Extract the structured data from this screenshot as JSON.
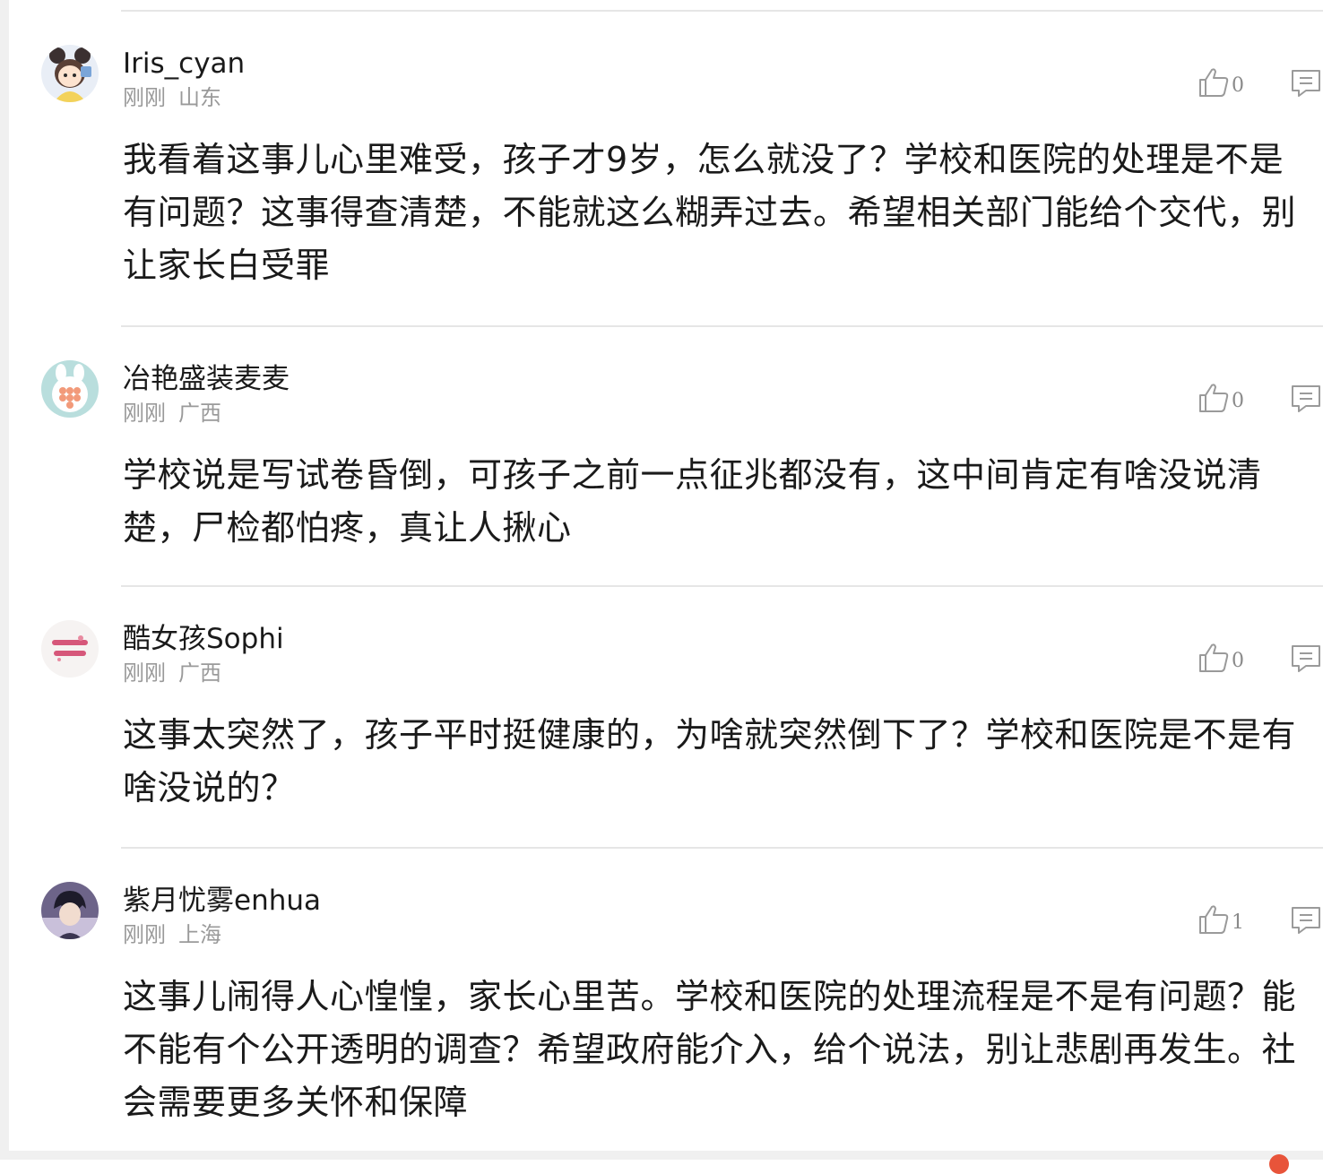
{
  "comments": [
    {
      "username": "Iris_cyan",
      "time": "刚刚",
      "location": "山东",
      "likes": "0",
      "content": "我看着这事儿心里难受，孩子才9岁，怎么就没了？学校和医院的处理是不是有问题？这事得查清楚，不能就这么糊弄过去。希望相关部门能给个交代，别让家长白受罪",
      "avatar_icon": "cartoon-girl-avatar"
    },
    {
      "username": "冶艳盛装麦麦",
      "time": "刚刚",
      "location": "广西",
      "likes": "0",
      "content": "学校说是写试卷昏倒，可孩子之前一点征兆都没有，这中间肯定有啥没说清楚，尸检都怕疼，真让人揪心",
      "avatar_icon": "bunny-toy-avatar"
    },
    {
      "username": "酷女孩Sophi",
      "time": "刚刚",
      "location": "广西",
      "likes": "0",
      "content": "这事太突然了，孩子平时挺健康的，为啥就突然倒下了？学校和医院是不是有啥没说的？",
      "avatar_icon": "pink-text-avatar"
    },
    {
      "username": "紫月忧雾enhua",
      "time": "刚刚",
      "location": "上海",
      "likes": "1",
      "content": "这事儿闹得人心惶惶，家长心里苦。学校和医院的处理流程是不是有问题？能不能有个公开透明的调查？希望政府能介入，给个说法，别让悲剧再发生。社会需要更多关怀和保障",
      "avatar_icon": "anime-boy-avatar"
    }
  ],
  "colors": {
    "text": "#1a1a1a",
    "meta": "#9a9a9a",
    "divider": "#e6e6e6",
    "icon": "#9a9a9a",
    "badge": "#e8543a"
  }
}
